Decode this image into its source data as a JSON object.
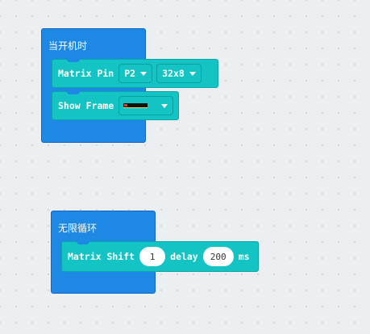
{
  "colors": {
    "event_block": "#1e88e5",
    "command_block": "#14c3c3",
    "workspace": "#eceff1"
  },
  "on_start": {
    "title": "当开机时",
    "matrix_pin": {
      "label": "Matrix Pin",
      "pin_value": "P2",
      "size_value": "32x8"
    },
    "show_frame": {
      "label": "Show Frame",
      "frame_icon": "led-frame-preview-icon"
    }
  },
  "forever": {
    "title": "无限循环",
    "matrix_shift": {
      "label": "Matrix Shift",
      "shift_value": "1",
      "delay_label": "delay",
      "delay_value": "200",
      "unit_label": "ms"
    }
  }
}
